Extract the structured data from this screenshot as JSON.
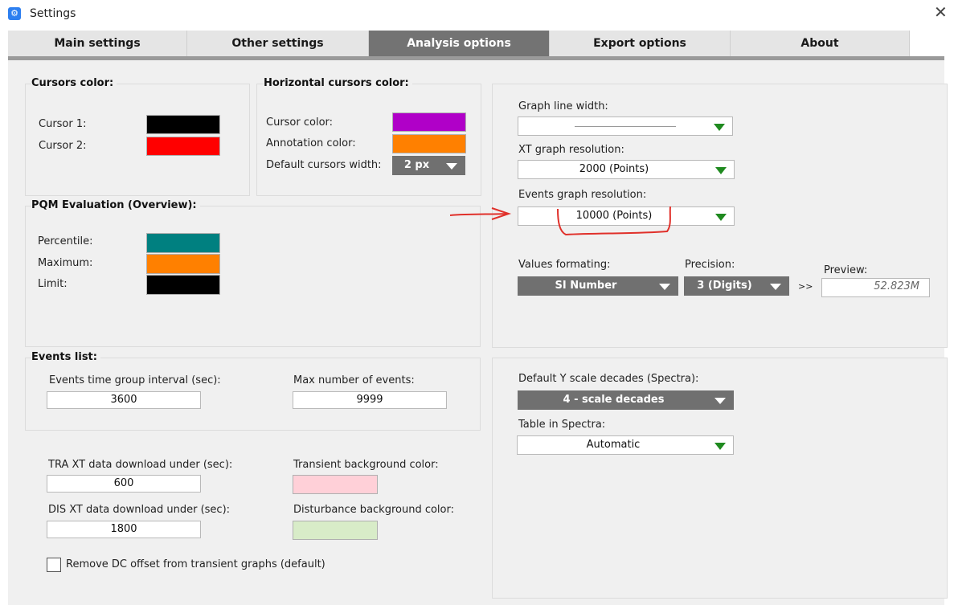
{
  "window": {
    "title": "Settings",
    "close_glyph": "✕",
    "icon": "settings-app-icon"
  },
  "tabs": [
    {
      "label": "Main settings"
    },
    {
      "label": "Other settings"
    },
    {
      "label": "Analysis options",
      "active": true
    },
    {
      "label": "Export options"
    },
    {
      "label": "About"
    }
  ],
  "cursors": {
    "title": "Cursors color:",
    "items": [
      {
        "label": "Cursor 1:",
        "color": "#000000"
      },
      {
        "label": "Cursor 2:",
        "color": "#ff0000"
      }
    ]
  },
  "hcursors": {
    "title": "Horizontal cursors color:",
    "cursor_label": "Cursor color:",
    "cursor_color": "#b000c8",
    "annotation_label": "Annotation color:",
    "annotation_color": "#ff8000",
    "width_label": "Default cursors width:",
    "width_value": "2 px"
  },
  "pqm": {
    "title": "PQM Evaluation (Overview):",
    "items": [
      {
        "label": "Percentile:",
        "color": "#008080"
      },
      {
        "label": "Maximum:",
        "color": "#ff8000"
      },
      {
        "label": "Limit:",
        "color": "#000000"
      }
    ]
  },
  "events": {
    "title": "Events list:",
    "interval_label": "Events time group interval (sec):",
    "interval_value": "3600",
    "max_label": "Max number of events:",
    "max_value": "9999"
  },
  "downloads": {
    "tra_label": "TRA XT data download under (sec):",
    "tra_value": "600",
    "dis_label": "DIS XT data download under (sec):",
    "dis_value": "1800",
    "transient_bg_label": "Transient background color:",
    "transient_bg_color": "#ffd0d8",
    "disturbance_bg_label": "Disturbance background color:",
    "disturbance_bg_color": "#d8ecc8",
    "dc_offset_label": "Remove DC offset from transient graphs (default)",
    "dc_offset_checked": false
  },
  "graph": {
    "line_width_label": "Graph line width:",
    "xt_label": "XT graph resolution:",
    "xt_value": "2000 (Points)",
    "events_label": "Events graph resolution:",
    "events_value": "10000 (Points)",
    "formatting_label": "Values formating:",
    "formatting_value": "SI Number",
    "precision_label": "Precision:",
    "precision_value": "3 (Digits)",
    "arrow": ">>",
    "preview_label": "Preview:",
    "preview_value": "52.823M"
  },
  "spectra": {
    "decades_label": "Default Y scale decades (Spectra):",
    "decades_value": "4 - scale decades",
    "table_label": "Table in Spectra:",
    "table_value": "Automatic"
  },
  "annotation": {
    "color": "#e0302a"
  }
}
